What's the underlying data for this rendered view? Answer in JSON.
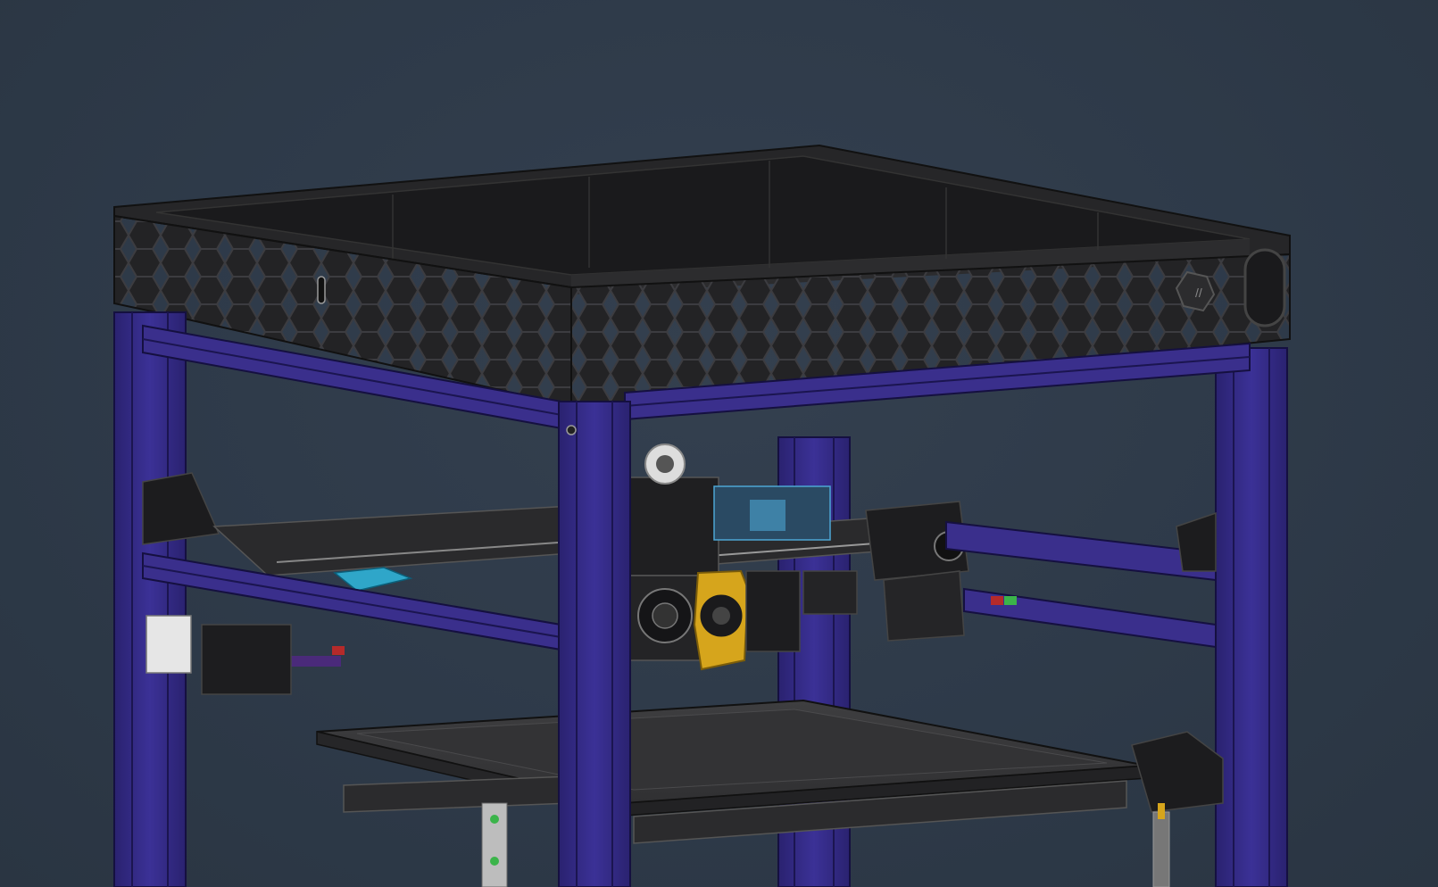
{
  "scene": {
    "background": "#2f3a48",
    "frame_color": "#3a2f8c",
    "frame_dark": "#241d5e",
    "part_black": "#1d1d1f",
    "part_dark": "#2a2a2c",
    "accent_blue": "#2fa6c9",
    "accent_yellow": "#d6a51c",
    "accent_red": "#b52a2a",
    "accent_green": "#3bb44a"
  }
}
